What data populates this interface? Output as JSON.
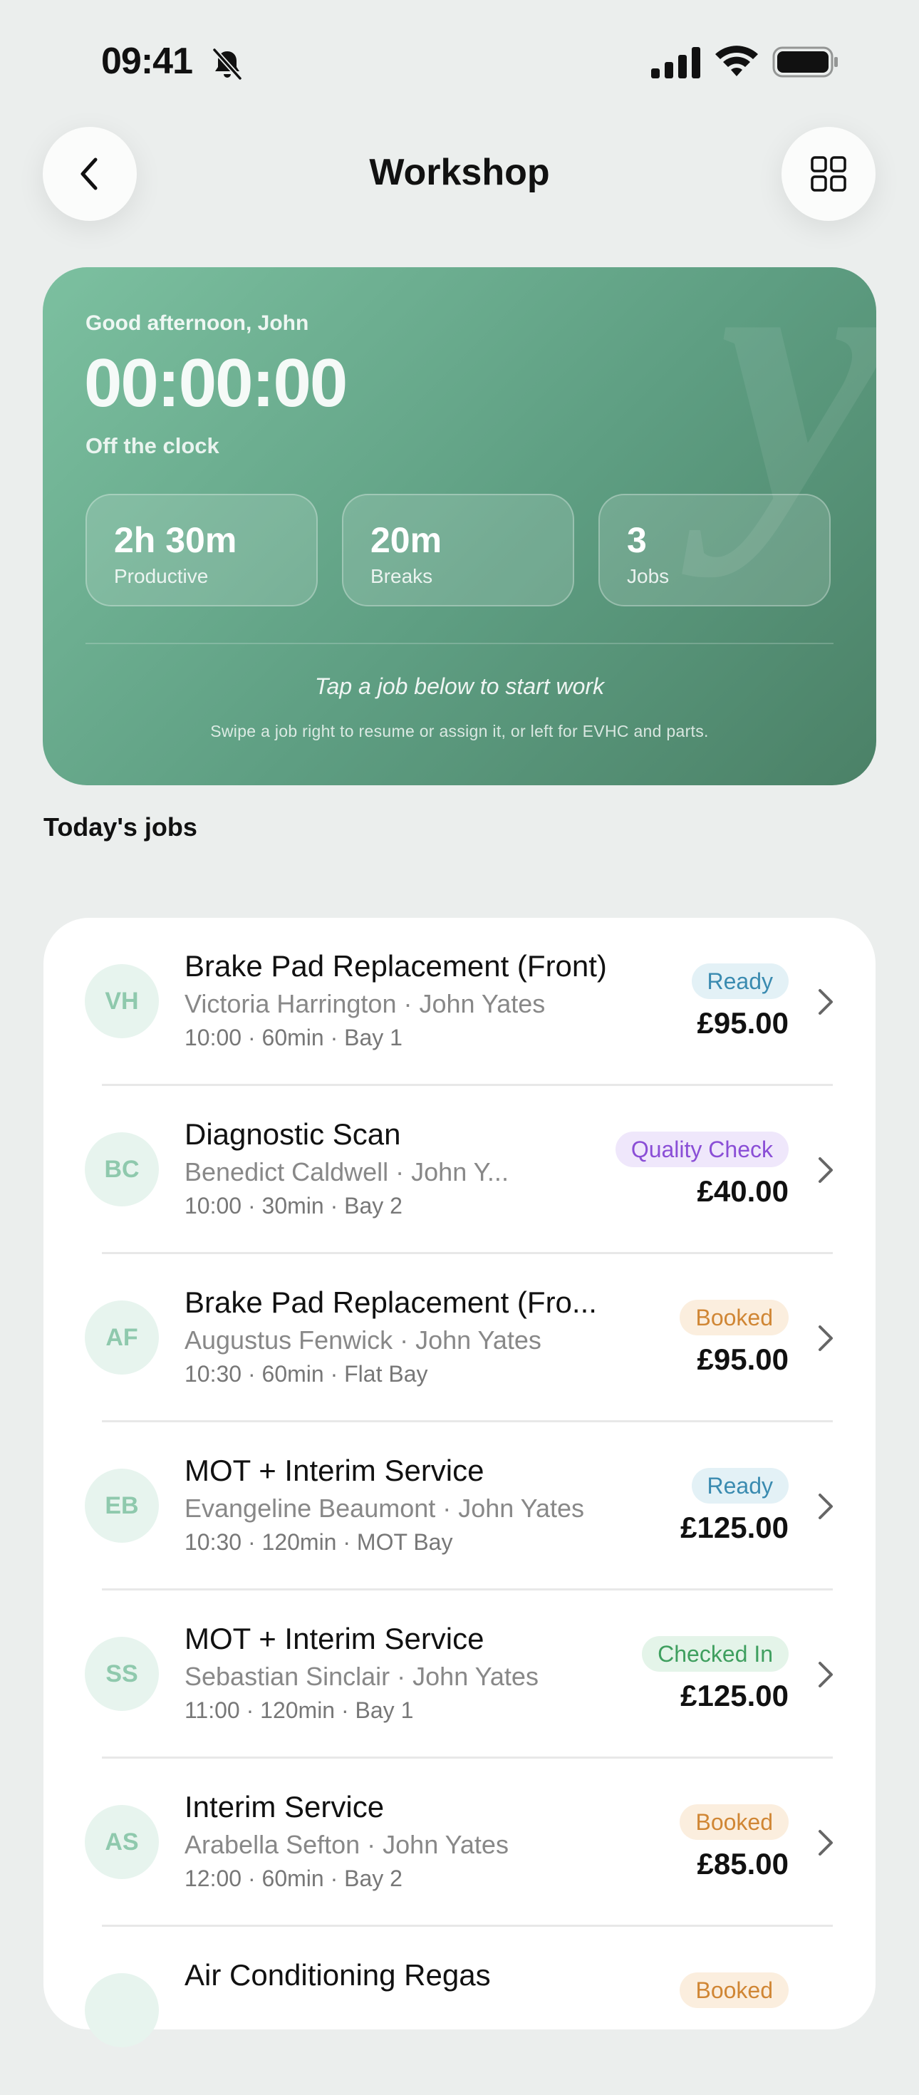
{
  "status_bar": {
    "time": "09:41"
  },
  "header": {
    "title": "Workshop"
  },
  "hero": {
    "greeting": "Good afternoon, John",
    "clock": "00:00:00",
    "clock_status": "Off the clock",
    "watermark": "y",
    "stats": [
      {
        "value": "2h 30m",
        "label": "Productive"
      },
      {
        "value": "20m",
        "label": "Breaks"
      },
      {
        "value": "3",
        "label": "Jobs"
      }
    ],
    "hint": "Tap a job below to start work",
    "sub_hint": "Swipe a job right to resume or assign it, or left for EVHC and parts."
  },
  "section": {
    "title": "Today's jobs"
  },
  "jobs": [
    {
      "initials": "VH",
      "title": "Brake Pad Replacement (Front)",
      "sub": "Victoria Harrington · John Yates",
      "meta": "10:00  ·  60min  ·  Bay 1",
      "status": "Ready",
      "status_type": "ready",
      "price": "£95.00"
    },
    {
      "initials": "BC",
      "title": "Diagnostic Scan",
      "sub": "Benedict Caldwell · John Y...",
      "meta": "10:00  ·  30min  ·  Bay 2",
      "status": "Quality Check",
      "status_type": "quality",
      "price": "£40.00"
    },
    {
      "initials": "AF",
      "title": "Brake Pad Replacement (Fro...",
      "sub": "Augustus Fenwick · John Yates",
      "meta": "10:30  ·  60min  ·  Flat Bay",
      "status": "Booked",
      "status_type": "booked",
      "price": "£95.00"
    },
    {
      "initials": "EB",
      "title": "MOT + Interim Service",
      "sub": "Evangeline Beaumont · John Yates",
      "meta": "10:30  ·  120min  ·  MOT Bay",
      "status": "Ready",
      "status_type": "ready",
      "price": "£125.00"
    },
    {
      "initials": "SS",
      "title": "MOT + Interim Service",
      "sub": "Sebastian Sinclair · John Yates",
      "meta": "11:00  ·  120min  ·  Bay 1",
      "status": "Checked In",
      "status_type": "checked",
      "price": "£125.00"
    },
    {
      "initials": "AS",
      "title": "Interim Service",
      "sub": "Arabella Sefton · John Yates",
      "meta": "12:00  ·  60min  ·  Bay 2",
      "status": "Booked",
      "status_type": "booked",
      "price": "£85.00"
    },
    {
      "initials": "",
      "title": "Air Conditioning Regas",
      "sub": "",
      "meta": "",
      "status": "Booked",
      "status_type": "booked",
      "price": ""
    }
  ],
  "icons": {
    "status": [
      "bell-slash-icon",
      "signal-icon",
      "wifi-icon",
      "battery-icon"
    ],
    "header": [
      "chevron-left-icon",
      "grid-icon"
    ],
    "row": "chevron-right-icon"
  },
  "colors": {
    "background": "#ebeeed",
    "hero_start": "#7cc0a0",
    "hero_end": "#4b8167",
    "ready": "#3a8bb0",
    "quality": "#8a4ed6",
    "booked": "#d08634",
    "checked_in": "#3f9f5f"
  }
}
